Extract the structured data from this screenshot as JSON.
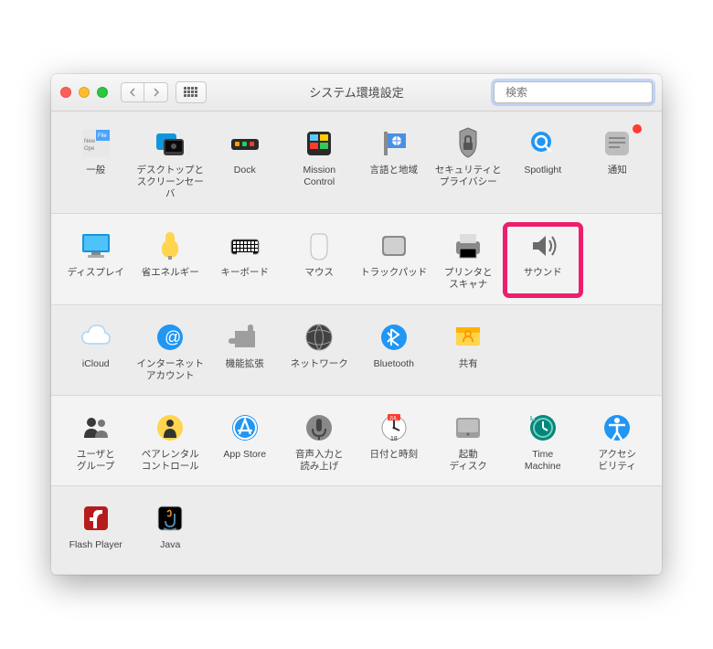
{
  "window": {
    "title": "システム環境設定",
    "search_placeholder": "検索"
  },
  "rows": [
    {
      "alt": false,
      "items": [
        {
          "id": "general",
          "label": "一般",
          "icon": "general"
        },
        {
          "id": "desktop",
          "label": "デスクトップと\nスクリーンセーバ",
          "icon": "desktop"
        },
        {
          "id": "dock",
          "label": "Dock",
          "icon": "dock"
        },
        {
          "id": "mission",
          "label": "Mission\nControl",
          "icon": "mission"
        },
        {
          "id": "lang",
          "label": "言語と地域",
          "icon": "lang"
        },
        {
          "id": "security",
          "label": "セキュリティと\nプライバシー",
          "icon": "security"
        },
        {
          "id": "spotlight",
          "label": "Spotlight",
          "icon": "spotlight"
        },
        {
          "id": "notify",
          "label": "通知",
          "icon": "notify",
          "badge": true
        }
      ]
    },
    {
      "alt": true,
      "items": [
        {
          "id": "display",
          "label": "ディスプレイ",
          "icon": "display"
        },
        {
          "id": "energy",
          "label": "省エネルギー",
          "icon": "energy"
        },
        {
          "id": "keyboard",
          "label": "キーボード",
          "icon": "keyboard"
        },
        {
          "id": "mouse",
          "label": "マウス",
          "icon": "mouse"
        },
        {
          "id": "trackpad",
          "label": "トラックパッド",
          "icon": "trackpad"
        },
        {
          "id": "printer",
          "label": "プリンタと\nスキャナ",
          "icon": "printer"
        },
        {
          "id": "sound",
          "label": "サウンド",
          "icon": "sound",
          "highlight": true
        }
      ]
    },
    {
      "alt": false,
      "items": [
        {
          "id": "icloud",
          "label": "iCloud",
          "icon": "icloud"
        },
        {
          "id": "internet",
          "label": "インターネット\nアカウント",
          "icon": "internet"
        },
        {
          "id": "ext",
          "label": "機能拡張",
          "icon": "ext"
        },
        {
          "id": "network",
          "label": "ネットワーク",
          "icon": "network"
        },
        {
          "id": "bluetooth",
          "label": "Bluetooth",
          "icon": "bluetooth"
        },
        {
          "id": "sharing",
          "label": "共有",
          "icon": "sharing"
        }
      ]
    },
    {
      "alt": true,
      "items": [
        {
          "id": "users",
          "label": "ユーザと\nグループ",
          "icon": "users"
        },
        {
          "id": "parental",
          "label": "ペアレンタル\nコントロール",
          "icon": "parental"
        },
        {
          "id": "appstore",
          "label": "App Store",
          "icon": "appstore"
        },
        {
          "id": "dictation",
          "label": "音声入力と\n読み上げ",
          "icon": "dictation"
        },
        {
          "id": "datetime",
          "label": "日付と時刻",
          "icon": "datetime"
        },
        {
          "id": "startup",
          "label": "起動\nディスク",
          "icon": "startup"
        },
        {
          "id": "tm",
          "label": "Time\nMachine",
          "icon": "tm"
        },
        {
          "id": "a11y",
          "label": "アクセシ\nビリティ",
          "icon": "a11y"
        }
      ]
    },
    {
      "alt": false,
      "items": [
        {
          "id": "flash",
          "label": "Flash Player",
          "icon": "flash"
        },
        {
          "id": "java",
          "label": "Java",
          "icon": "java"
        }
      ]
    }
  ]
}
